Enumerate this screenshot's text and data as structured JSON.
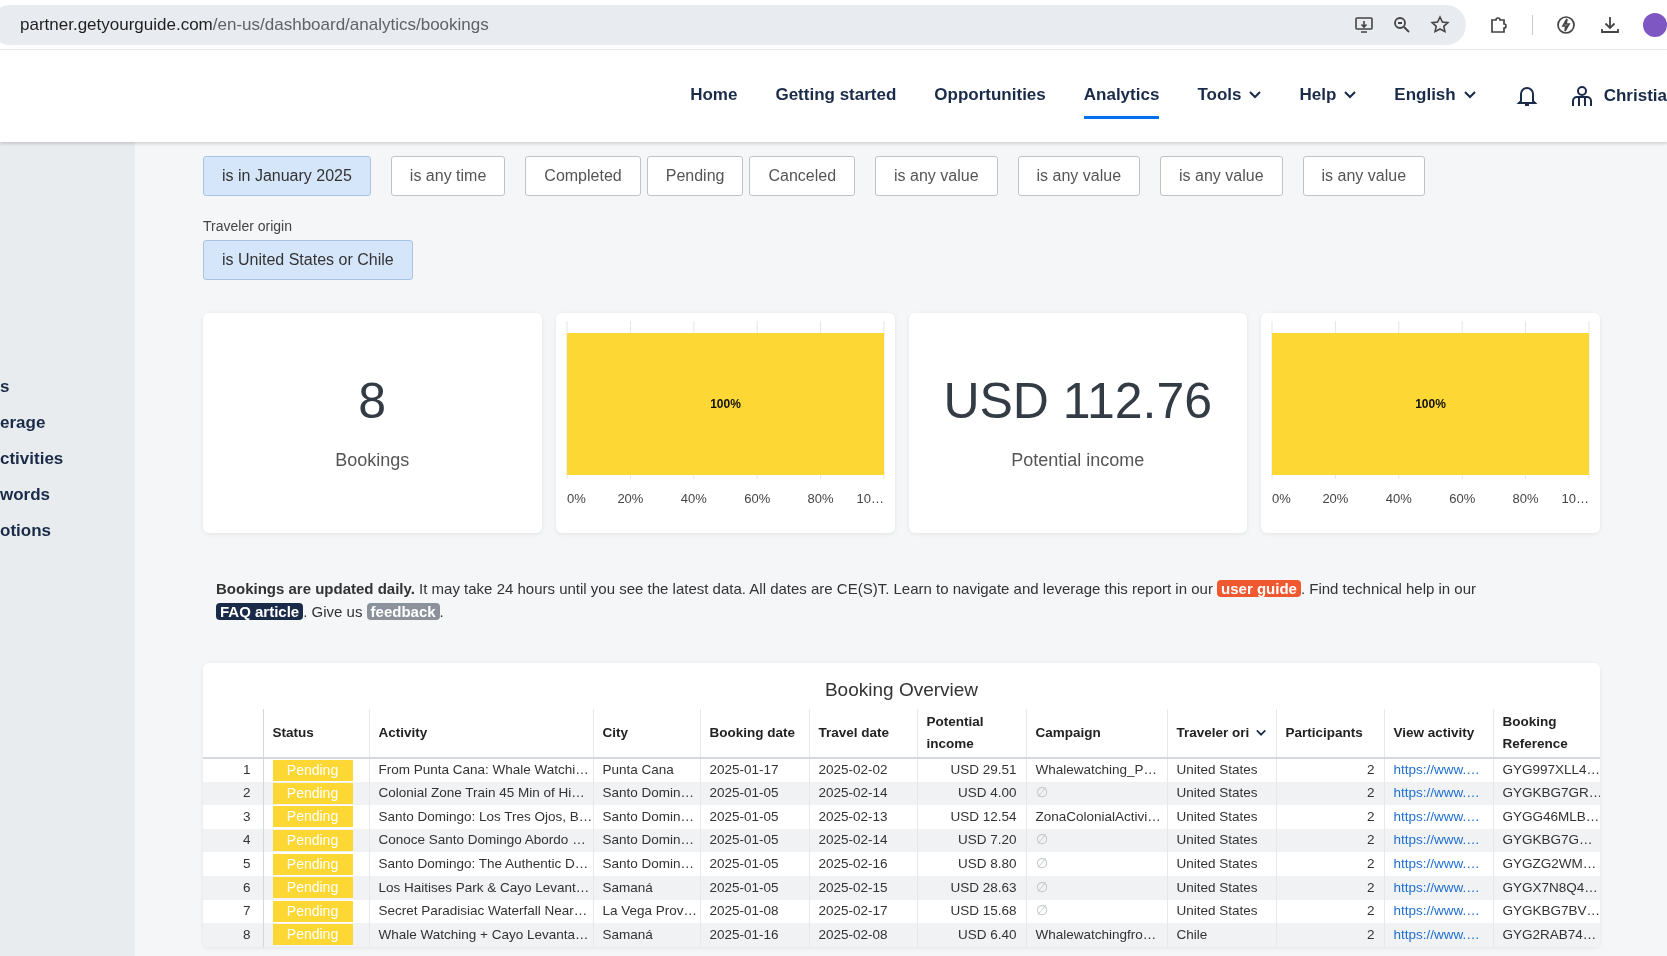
{
  "browser": {
    "url_host": "partner.getyourguide.com",
    "url_path": "/en-us/dashboard/analytics/bookings"
  },
  "nav": {
    "items": [
      {
        "label": "Home",
        "selected": false,
        "dropdown": false
      },
      {
        "label": "Getting started",
        "selected": false,
        "dropdown": false
      },
      {
        "label": "Opportunities",
        "selected": false,
        "dropdown": false
      },
      {
        "label": "Analytics",
        "selected": true,
        "dropdown": false
      },
      {
        "label": "Tools",
        "selected": false,
        "dropdown": true
      },
      {
        "label": "Help",
        "selected": false,
        "dropdown": true
      },
      {
        "label": "English",
        "selected": false,
        "dropdown": true
      }
    ],
    "user": "Christia"
  },
  "sidebar": {
    "items": [
      "s",
      "erage",
      "ctivities",
      "words",
      "otions"
    ]
  },
  "filter_rows": [
    {
      "groups": [
        {
          "chips": [
            {
              "label": "is in January 2025",
              "selected": true
            }
          ]
        },
        {
          "chips": [
            {
              "label": "is any time",
              "selected": false
            }
          ]
        },
        {
          "chips": [
            {
              "label": "Completed",
              "selected": false
            },
            {
              "label": "Pending",
              "selected": false
            },
            {
              "label": "Canceled",
              "selected": false
            }
          ]
        },
        {
          "chips": [
            {
              "label": "is any value",
              "selected": false
            }
          ]
        },
        {
          "chips": [
            {
              "label": "is any value",
              "selected": false
            }
          ]
        },
        {
          "chips": [
            {
              "label": "is any value",
              "selected": false
            }
          ]
        },
        {
          "chips": [
            {
              "label": "is any value",
              "selected": false
            }
          ]
        }
      ]
    },
    {
      "groups": [
        {
          "label": "Traveler origin",
          "chips": [
            {
              "label": "is United States or Chile",
              "selected": true
            }
          ]
        }
      ]
    }
  ],
  "cards": [
    {
      "kind": "metric",
      "value": "8",
      "label": "Bookings"
    },
    {
      "kind": "chart",
      "chart_data": {
        "type": "bar",
        "orientation": "horizontal",
        "grid": true,
        "values": [
          1
        ],
        "xlim": [
          0,
          1
        ],
        "xticks": [
          {
            "value": 0,
            "label": "0%"
          },
          {
            "value": 0.2,
            "label": "20%"
          },
          {
            "value": 0.4,
            "label": "40%"
          },
          {
            "value": 0.6,
            "label": "60%"
          },
          {
            "value": 0.8,
            "label": "80%"
          },
          {
            "value": 1,
            "label": "10…"
          }
        ],
        "value_labels": [
          "100%"
        ]
      }
    },
    {
      "kind": "metric",
      "value": "USD 112.76",
      "label": "Potential income"
    },
    {
      "kind": "chart",
      "chart_data": {
        "type": "bar",
        "orientation": "horizontal",
        "grid": true,
        "values": [
          1
        ],
        "xlim": [
          0,
          1
        ],
        "xticks": [
          {
            "value": 0,
            "label": "0%"
          },
          {
            "value": 0.2,
            "label": "20%"
          },
          {
            "value": 0.4,
            "label": "40%"
          },
          {
            "value": 0.6,
            "label": "60%"
          },
          {
            "value": 0.8,
            "label": "80%"
          },
          {
            "value": 1,
            "label": "10…"
          }
        ],
        "value_labels": [
          "100%"
        ]
      }
    }
  ],
  "notice": {
    "parts": [
      {
        "kind": "text",
        "text": "**Bookings are updated daily.** It may take 24 hours until you see the latest data. All dates are CE(S)T. Learn to navigate and leverage this report in our "
      },
      {
        "kind": "link",
        "text": "user guide",
        "color": "#f0582f"
      },
      {
        "kind": "text",
        "text": ". Find technical help in our "
      },
      {
        "kind": "link",
        "text": "FAQ article",
        "color": "#1a2b49"
      },
      {
        "kind": "text",
        "text": ". Give us "
      },
      {
        "kind": "link",
        "text": "feedback",
        "color": "#8b929c"
      },
      {
        "kind": "text",
        "text": "."
      }
    ]
  },
  "table": {
    "title": "Booking Overview",
    "columns": [
      {
        "label": "Status",
        "kind": "badge"
      },
      {
        "label": "Activity",
        "kind": "text"
      },
      {
        "label": "City",
        "kind": "text"
      },
      {
        "label": "Booking date",
        "kind": "text"
      },
      {
        "label": "Travel date",
        "kind": "text"
      },
      {
        "label": "Potential income",
        "kind": "number"
      },
      {
        "label": "Campaign",
        "kind": "text"
      },
      {
        "label": "Traveler ori",
        "kind": "text",
        "dropdown": true
      },
      {
        "label": "Participants",
        "kind": "number"
      },
      {
        "label": "View activity",
        "kind": "link"
      },
      {
        "label": "Booking Reference",
        "kind": "text"
      }
    ],
    "rows": [
      {
        "index": "1",
        "cells": [
          "Pending",
          "From Punta Cana: Whale Watchi…",
          "Punta Cana",
          "2025-01-17",
          "2025-02-02",
          "USD 29.51",
          {
            "text": "Whalewatching_P…",
            "empty": false
          },
          "United States",
          "2",
          "https://www.…",
          "GYG997XLL4…"
        ]
      },
      {
        "index": "2",
        "cells": [
          "Pending",
          "Colonial Zone Train 45 Min of Hi…",
          "Santo Domin…",
          "2025-01-05",
          "2025-02-14",
          "USD 4.00",
          {
            "text": "∅",
            "empty": true
          },
          "United States",
          "2",
          "https://www.…",
          "GYGKBG7GR…"
        ]
      },
      {
        "index": "3",
        "cells": [
          "Pending",
          "Santo Domingo: Los Tres Ojos, B…",
          "Santo Domin…",
          "2025-01-05",
          "2025-02-13",
          "USD 12.54",
          {
            "text": "ZonaColonialActivi…",
            "empty": false
          },
          "United States",
          "2",
          "https://www.…",
          "GYGG46MLB…"
        ]
      },
      {
        "index": "4",
        "cells": [
          "Pending",
          "Conoce Santo Domingo Abordo …",
          "Santo Domin…",
          "2025-01-05",
          "2025-02-14",
          "USD 7.20",
          {
            "text": "∅",
            "empty": true
          },
          "United States",
          "2",
          "https://www.…",
          "GYGKBG7G…"
        ]
      },
      {
        "index": "5",
        "cells": [
          "Pending",
          "Santo Domingo: The Authentic D…",
          "Santo Domin…",
          "2025-01-05",
          "2025-02-16",
          "USD 8.80",
          {
            "text": "∅",
            "empty": true
          },
          "United States",
          "2",
          "https://www.…",
          "GYGZG2WM…"
        ]
      },
      {
        "index": "6",
        "cells": [
          "Pending",
          "Los Haitises Park & Cayo Levant…",
          "Samaná",
          "2025-01-05",
          "2025-02-15",
          "USD 28.63",
          {
            "text": "∅",
            "empty": true
          },
          "United States",
          "2",
          "https://www.…",
          "GYGX7N8Q4…"
        ]
      },
      {
        "index": "7",
        "cells": [
          "Pending",
          "Secret Paradisiac Waterfall Near…",
          "La Vega Prov…",
          "2025-01-08",
          "2025-02-17",
          "USD 15.68",
          {
            "text": "∅",
            "empty": true
          },
          "United States",
          "2",
          "https://www.…",
          "GYGKBG7BV…"
        ]
      },
      {
        "index": "8",
        "cells": [
          "Pending",
          "Whale Watching + Cayo Levanta…",
          "Samaná",
          "2025-01-16",
          "2025-02-08",
          "USD 6.40",
          {
            "text": "Whalewatchingfro…",
            "empty": false
          },
          "Chile",
          "2",
          "https://www.…",
          "GYG2RAB74…"
        ]
      }
    ]
  }
}
